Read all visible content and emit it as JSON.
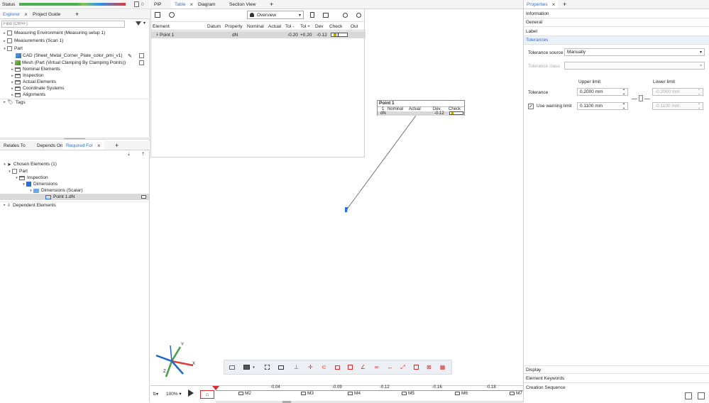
{
  "status": {
    "label": "Status",
    "count": "0"
  },
  "left_tabs": {
    "explorer": "Explorer",
    "project_guide": "Project Guide"
  },
  "find": {
    "placeholder": "Find (Ctrl+F)"
  },
  "explorer_tree": {
    "measuring_env": "Measuring Environment (Measuring setup 1)",
    "measurements": "Measurements (Scan 1)",
    "part": "Part",
    "cad": "CAD (Sheet_Metal_Corner_Plate_color_pmi_v1)",
    "mesh": "Mesh (Part (Virtual Clamping By Clamping Points))",
    "nominal": "Nominal Elements",
    "inspection": "Inspection",
    "actual": "Actual Elements",
    "coords": "Coordinate Systems",
    "alignments": "Alignments",
    "tags": "Tags"
  },
  "dep_tabs": {
    "relates_to": "Relates To",
    "depends_on": "Depends On",
    "required_for": "Required For"
  },
  "dep_tree": {
    "chosen": "Chosen Elements (1)",
    "part": "Part",
    "inspection": "Inspection",
    "dimensions": "Dimensions",
    "dimensions_scalar": "Dimensions (Scalar)",
    "point": "Point 1.dN",
    "dependent": "Dependent Elements"
  },
  "center_tabs": {
    "pip": "PIP",
    "table": "Table",
    "diagram": "Diagram",
    "section": "Section View"
  },
  "table_toolbar": {
    "overview": "Overview"
  },
  "table": {
    "headers": [
      "Element",
      "Datum",
      "Property",
      "Nominal",
      "Actual",
      "Tol -",
      "Tol +",
      "Dev",
      "Check",
      "Out"
    ],
    "rows": [
      {
        "element": "Point 1",
        "datum": "",
        "property": "dN",
        "nominal": "",
        "actual": "",
        "tol_minus": "-0.20",
        "tol_plus": "+0.20",
        "dev": "-0.12",
        "out": ""
      }
    ]
  },
  "label": {
    "title": "Point 1",
    "headers": [
      "Nominal",
      "Actual",
      "Dev.",
      "Check"
    ],
    "row_index": "1",
    "property": "dN",
    "dev": "-0.12"
  },
  "axes": {
    "x": "X",
    "y": "Y",
    "z": "Z"
  },
  "timeline": {
    "zoom": "100%",
    "markers": [
      "M2",
      "M3",
      "M4",
      "M5",
      "M6",
      "M7"
    ],
    "values": [
      "-0.04",
      "-0.09",
      "-0.12",
      "-0.16",
      "-0.18"
    ]
  },
  "properties_tab": {
    "label": "Properties"
  },
  "properties": {
    "information": "Information",
    "general": "General",
    "label": "Label",
    "tolerances": "Tolerances",
    "tolerance_source_label": "Tolerance source",
    "tolerance_source_value": "Manually",
    "tolerance_class_label": "Tolerance class",
    "upper_limit": "Upper limit",
    "lower_limit": "Lower limit",
    "tolerance_label": "Tolerance",
    "tolerance_upper": "0.2000 mm",
    "tolerance_lower": "-0.2000 mm",
    "warning_label": "Use warning limit",
    "warning_upper": "0.1100 mm",
    "warning_lower": "-0.1100 mm",
    "display": "Display",
    "element_keywords": "Element Keywords",
    "creation_sequence": "Creation Sequence"
  },
  "colors": {
    "accent": "#2d6fd3",
    "pass": "#3c8a3c"
  }
}
